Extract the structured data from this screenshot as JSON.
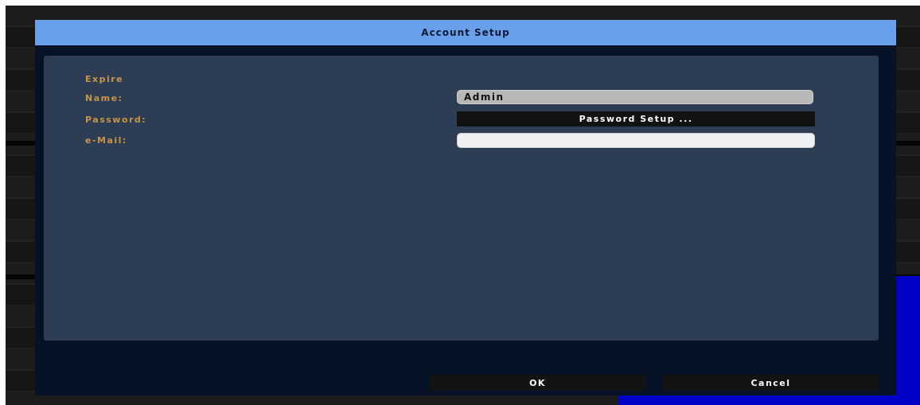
{
  "dialog": {
    "title": "Account Setup"
  },
  "form": {
    "expire_label": "Expire",
    "name_label": "Name:",
    "name_value": "Admin",
    "password_label": "Password:",
    "password_button_label": "Password Setup ...",
    "email_label": "e-Mail:",
    "email_value": ""
  },
  "footer": {
    "ok_label": "OK",
    "cancel_label": "Cancel"
  },
  "colors": {
    "titlebar": "#6aa0eb",
    "panel": "#2d3d54",
    "label_text": "#c7944a",
    "dialog_bg": "#061226",
    "background_block": "#0000c8"
  }
}
